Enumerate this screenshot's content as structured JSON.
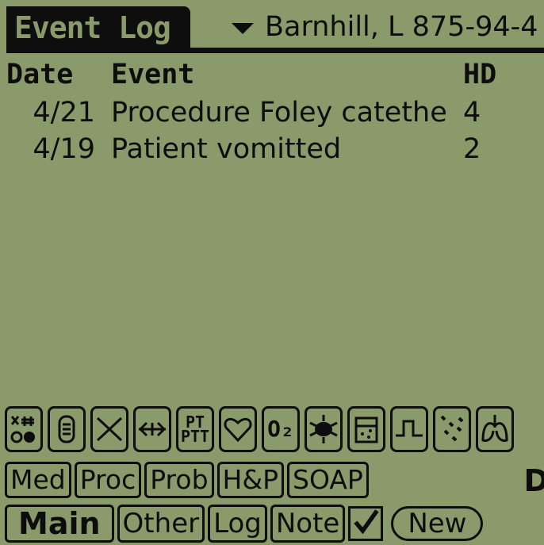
{
  "header": {
    "title": "Event Log",
    "patient": "Barnhill, L 875-94-4"
  },
  "table": {
    "columns": {
      "date": "Date",
      "event": "Event",
      "hd": "HD"
    },
    "rows": [
      {
        "date": "4/21",
        "event": "Procedure Foley catethe",
        "hd": "4"
      },
      {
        "date": "4/19",
        "event": "Patient vomitted",
        "hd": "2"
      }
    ]
  },
  "icon_bar": {
    "items": [
      {
        "icon": "ktr-lab-icon",
        "text": ""
      },
      {
        "icon": "iv-bag-icon",
        "text": ""
      },
      {
        "icon": "x-icon",
        "text": ""
      },
      {
        "icon": "arrow-line-icon",
        "text": ""
      },
      {
        "icon": "pt-ptt-icon",
        "top": "PT",
        "bottom": "PTT"
      },
      {
        "icon": "heart-icon",
        "text": ""
      },
      {
        "icon": "o2-icon",
        "text": "O₂"
      },
      {
        "icon": "bug-icon",
        "text": ""
      },
      {
        "icon": "beaker-icon",
        "text": ""
      },
      {
        "icon": "pulse-icon",
        "text": ""
      },
      {
        "icon": "scatter-icon",
        "text": ""
      },
      {
        "icon": "lungs-icon",
        "text": ""
      }
    ]
  },
  "categories": [
    "Med",
    "Proc",
    "Prob",
    "H&P",
    "SOAP"
  ],
  "category_right": "D",
  "nav": {
    "items": [
      "Main",
      "Other",
      "Log",
      "Note"
    ],
    "active": "Main",
    "new_label": "New"
  }
}
